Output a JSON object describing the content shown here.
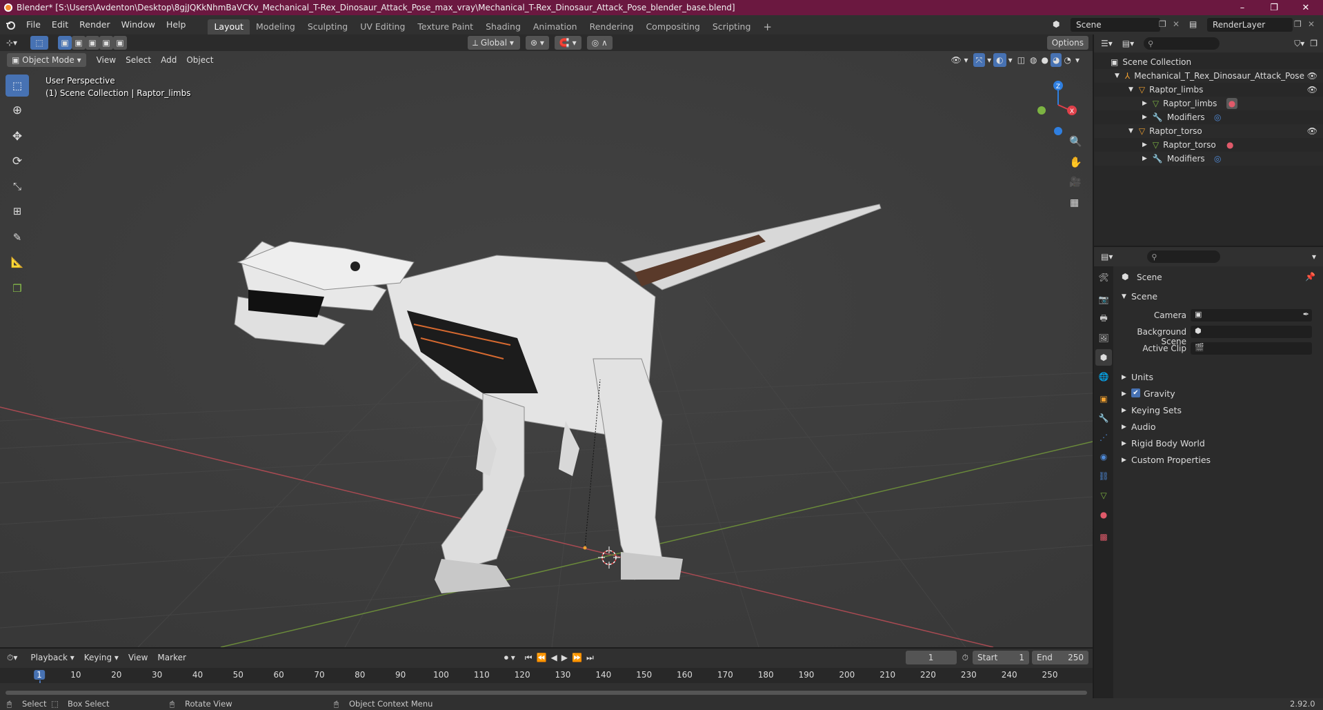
{
  "window": {
    "title": "Blender* [S:\\Users\\Avdenton\\Desktop\\8gjJQKkNhmBaVCKv_Mechanical_T-Rex_Dinosaur_Attack_Pose_max_vray\\Mechanical_T-Rex_Dinosaur_Attack_Pose_blender_base.blend]",
    "controls": [
      "–",
      "❐",
      "✕"
    ]
  },
  "menubar": {
    "items": [
      "File",
      "Edit",
      "Render",
      "Window",
      "Help"
    ],
    "workspaces": [
      "Layout",
      "Modeling",
      "Sculpting",
      "UV Editing",
      "Texture Paint",
      "Shading",
      "Animation",
      "Rendering",
      "Compositing",
      "Scripting"
    ],
    "active_workspace": "Layout",
    "add_workspace": "+",
    "scene": "Scene",
    "view_layer": "RenderLayer"
  },
  "viewport": {
    "mode": "Object Mode",
    "menus": [
      "View",
      "Select",
      "Add",
      "Object"
    ],
    "orientation": "Global",
    "options": "Options",
    "overlay_line1": "User Perspective",
    "overlay_line2": "(1) Scene Collection | Raptor_limbs",
    "gizmo": {
      "z": "Z",
      "x": "X"
    }
  },
  "outliner": {
    "root": "Scene Collection",
    "rows": [
      {
        "label": "Mechanical_T_Rex_Dinosaur_Attack_Pose"
      },
      {
        "label": "Raptor_limbs"
      },
      {
        "label": "Raptor_limbs"
      },
      {
        "label": "Modifiers"
      },
      {
        "label": "Raptor_torso"
      },
      {
        "label": "Raptor_torso"
      },
      {
        "label": "Modifiers"
      }
    ]
  },
  "properties": {
    "header": "Scene",
    "panel": "Scene",
    "fields": [
      {
        "label": "Camera"
      },
      {
        "label": "Background Scene"
      },
      {
        "label": "Active Clip"
      }
    ],
    "sections": [
      "Units",
      "Gravity",
      "Keying Sets",
      "Audio",
      "Rigid Body World",
      "Custom Properties"
    ],
    "gravity_checked": true
  },
  "timeline": {
    "menus": [
      "Playback",
      "Keying",
      "View",
      "Marker"
    ],
    "current_frame": "1",
    "start_label": "Start",
    "start": "1",
    "end_label": "End",
    "end": "250",
    "ticks": [
      "1",
      "10",
      "20",
      "30",
      "40",
      "50",
      "60",
      "70",
      "80",
      "90",
      "100",
      "110",
      "120",
      "130",
      "140",
      "150",
      "160",
      "170",
      "180",
      "190",
      "200",
      "210",
      "220",
      "230",
      "240",
      "250"
    ]
  },
  "statusbar": {
    "select": "Select",
    "box_select": "Box Select",
    "rotate_view": "Rotate View",
    "context_menu": "Object Context Menu",
    "version": "2.92.0"
  },
  "colors": {
    "title_bg": "#6b1840",
    "accent": "#4772b3",
    "x_axis": "#e0404a",
    "y_axis": "#7cb342",
    "z_axis": "#2f7fe0"
  }
}
